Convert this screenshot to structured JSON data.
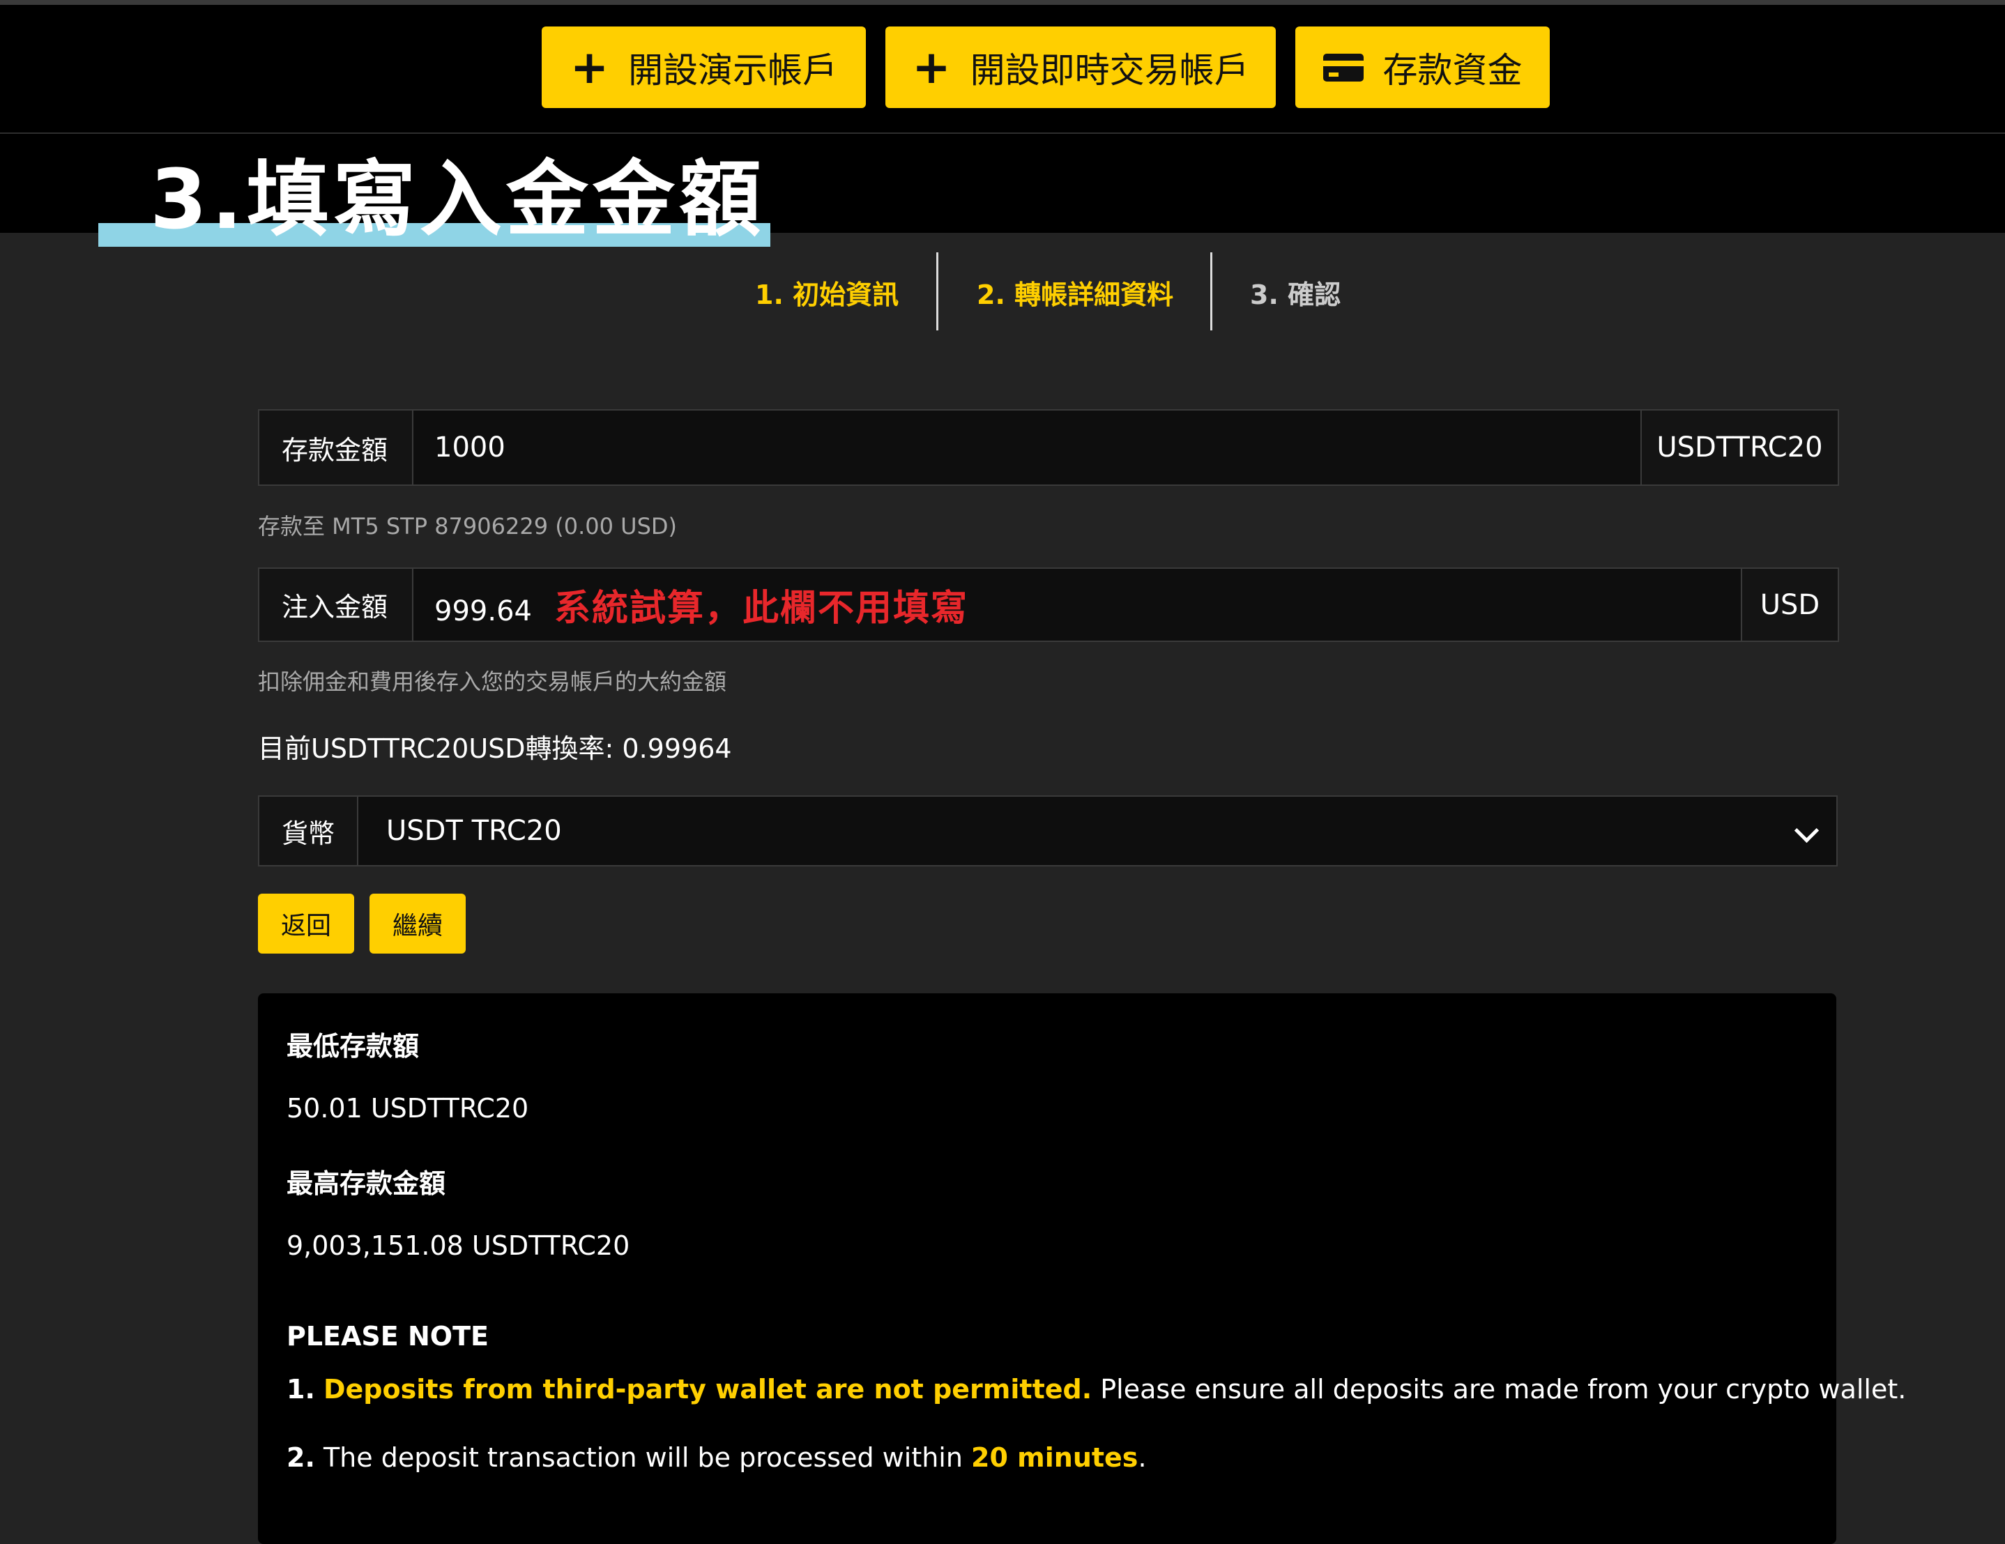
{
  "topbar": {
    "demo_button": "開設演示帳戶",
    "live_button": "開設即時交易帳戶",
    "deposit_button": "存款資金"
  },
  "heading": "3.填寫入金金額",
  "steps": [
    {
      "label": "1. 初始資訊",
      "state": "done"
    },
    {
      "label": "2. 轉帳詳細資料",
      "state": "active"
    },
    {
      "label": "3. 確認",
      "state": "pending"
    }
  ],
  "deposit_field": {
    "label": "存款金額",
    "value": "1000",
    "currency": "USDTTRC20"
  },
  "deposit_helper": "存款至 MT5 STP 87906229 (0.00 USD)",
  "inject_field": {
    "label": "注入金額",
    "value": "999.64",
    "note": "系統試算，此欄不用填寫",
    "currency": "USD"
  },
  "inject_helper": "扣除佣金和費用後存入您的交易帳戶的大約金額",
  "rate_text": "目前USDTTRC20USD轉換率: 0.99964",
  "currency_select": {
    "label": "貨幣",
    "selected": "USDT TRC20"
  },
  "buttons": {
    "back": "返回",
    "continue": "繼續"
  },
  "info": {
    "min_label": "最低存款額",
    "min_value": "50.01 USDTTRC20",
    "max_label": "最高存款金額",
    "max_value": "9,003,151.08 USDTTRC20",
    "note_title": "PLEASE NOTE",
    "note1_num": "1.",
    "note1_highlight": "Deposits from third-party wallet are not permitted.",
    "note1_rest": " Please ensure all deposits are made from your crypto wallet.",
    "note2_num": "2.",
    "note2_text": " The deposit transaction will be processed within ",
    "note2_highlight": "20 minutes",
    "note2_end": "."
  },
  "colors": {
    "accent": "#ffcf00",
    "note_red": "#e8272b",
    "heading_underline": "#8fd4e6",
    "step_active": "#ffcf00"
  }
}
